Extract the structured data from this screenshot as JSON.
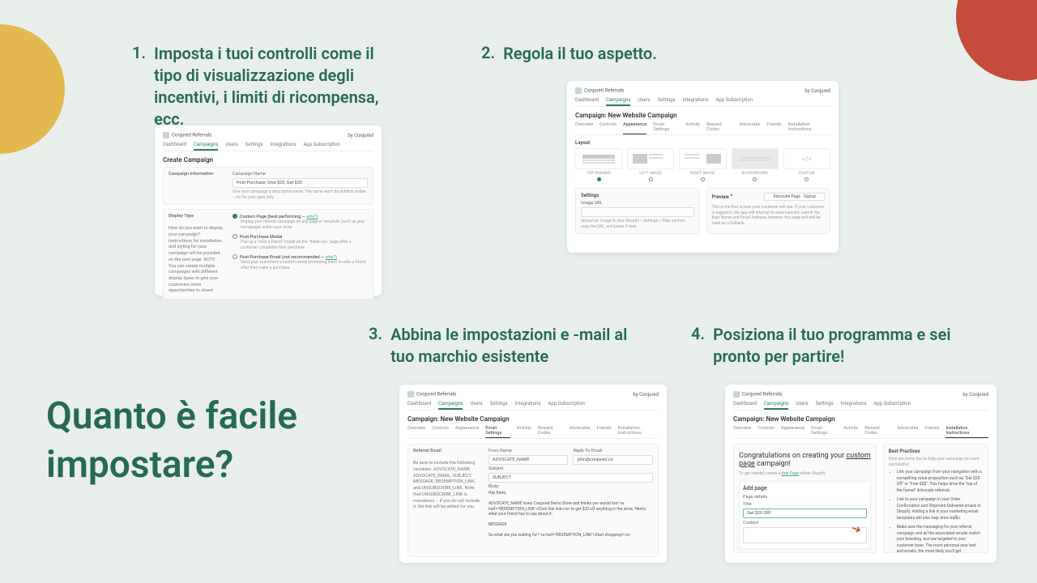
{
  "headline_l1": "Quanto è facile",
  "headline_l2": "impostare?",
  "steps": {
    "1": {
      "num": "1.",
      "text": "Imposta i tuoi controlli come il tipo di visualizzazione degli incentivi, i limiti di ricompensa, ecc."
    },
    "2": {
      "num": "2.",
      "text": "Regola il tuo aspetto."
    },
    "3": {
      "num": "3.",
      "text": "Abbina le impostazioni e -mail al tuo marchio esistente"
    },
    "4": {
      "num": "4.",
      "text": "Posiziona il tuo programma e sei pronto per partire!"
    }
  },
  "common": {
    "app": "Conjured Referrals",
    "by": "by Conjured",
    "nav": [
      "Dashboard",
      "Campaigns",
      "Users",
      "Settings",
      "Integrations",
      "App Subscription"
    ]
  },
  "shot1": {
    "title": "Create Campaign",
    "section": "Campaign Information",
    "cname_label": "Campaign Name",
    "cname_value": "Post-Purchase, Give $20, Get $20",
    "cname_help": "Give your campaign a descriptive name. The name won't be publicly visible – it's for your eyes only.",
    "display_type": "Display Type",
    "display_help": "How do you want to display your campaign? Instructions for installation and styling for your campaign will be provided on the next page. NOTE: You can create multiple campaigns with different display types to give your customers more opportunities to share!",
    "opt1": {
      "title": "Custom Page (best performing — ",
      "why": "why?)",
      "desc": "Display your referral campaign on any page or template (such as your homepage) within your store."
    },
    "opt2": {
      "title": "Post-Purchase Modal",
      "desc": "Pop up a \"refer a friend\" modal on the \"thank you\" page after a customer completes their purchase."
    },
    "opt3": {
      "title": "Post-Purchase Email (not recommended — ",
      "why": "why?)",
      "desc": "Send your customers a custom email prompting them to refer a friend after they make a purchase."
    }
  },
  "shot2": {
    "title": "Campaign: New Website Campaign",
    "subnav": [
      "Overview",
      "Controls",
      "Appearance",
      "Email Settings",
      "Activity",
      "Reward Codes",
      "Advocates",
      "Friends",
      "Installation Instructions"
    ],
    "layout_label": "Layout",
    "layouts": [
      "TOP BANNER",
      "LEFT IMAGE",
      "RIGHT IMAGE",
      "BACKGROUND",
      "CUSTOM"
    ],
    "settings": "Settings",
    "image_url": "Image URL",
    "image_help": "Upload an image to your Shopify > Settings > Files section, copy the URL, and paste it here.",
    "preview": "Preview",
    "preview_select": "Advocate Page - Signup",
    "preview_desc": "This is the first screen your customer will see. If your customer is logged in, the app will attempt to automatically submit the their Name and Email Address, however this page will still be used as a fallback."
  },
  "shot3": {
    "title": "Campaign: New Website Campaign",
    "subnav": [
      "Overview",
      "Controls",
      "Appearance",
      "Email Settings",
      "Activity",
      "Reward Codes",
      "Advocates",
      "Friends",
      "Installation Instructions"
    ],
    "section": "Referral Email",
    "left_help": "Be sure to include the following variables: ADVOCATE_NAME, ADVOCATE_EMAIL, SUBJECT, MESSAGE, REDEMPTION_LINK, and UNSUBSCRIBE_LINK. Note that UNSUBSCRIBE_LINK is mandatory – if you do not include it, the link will be added for you.",
    "from_name": "From Name",
    "from_val": "ADVOCATE_NAME",
    "reply_to": "Reply-To Email",
    "reply_val": "john@conjured.co",
    "subject": "Subject",
    "subject_val": "SUBJECT",
    "body": "Body:",
    "body_text": "Hey there,\n\nADVOCATE_NAME loves Conjured Demo Store and thinks you would too! <a href=\"REDEMPTION_LINK\">Click this link</a> to get $20 off anything in the store. Here's what your friend has to say about it:\n\nMESSAGE\n\nSo what are you waiting for? <a href=\"REDEMPTION_LINK\">Start shopping!</a>"
  },
  "shot4": {
    "title": "Campaign: New Website Campaign",
    "subnav": [
      "Overview",
      "Controls",
      "Appearance",
      "Email Settings",
      "Activity",
      "Reward Codes",
      "Advocates",
      "Friends",
      "Installation Instructions"
    ],
    "congrats": "Congratulations on creating your ",
    "congrats_ul": "custom page",
    "congrats_end": " campaign!",
    "started": "To get started, create a ",
    "started_link": "new Page",
    "started_end": " within Shopify.",
    "add_page": "Add page",
    "page_details": "Page details",
    "title_label": "Title",
    "title_val": "Get $20 Off!",
    "content_label": "Content",
    "bp_title": "Best Practices",
    "bp_intro": "Here are some tips to help your campaign be more successful:",
    "bp": [
      "Link your campaign from your navigation with a compelling value proposition such as \"Get $20 Off\" or \"Free $$$\". This helps drive the \"top of the funnel\" Advocate referrals.",
      "Link to your campaign in your Order Confirmation and Shipment Delivered emails in Shopify. Adding a link in your marketing email templates will also help drive traffic.",
      "Make sure the messaging for your referral campaign and all the associated emails match your branding, and are targeted to your customer base. The more personal your text and emails, the more likely you'll get"
    ]
  }
}
